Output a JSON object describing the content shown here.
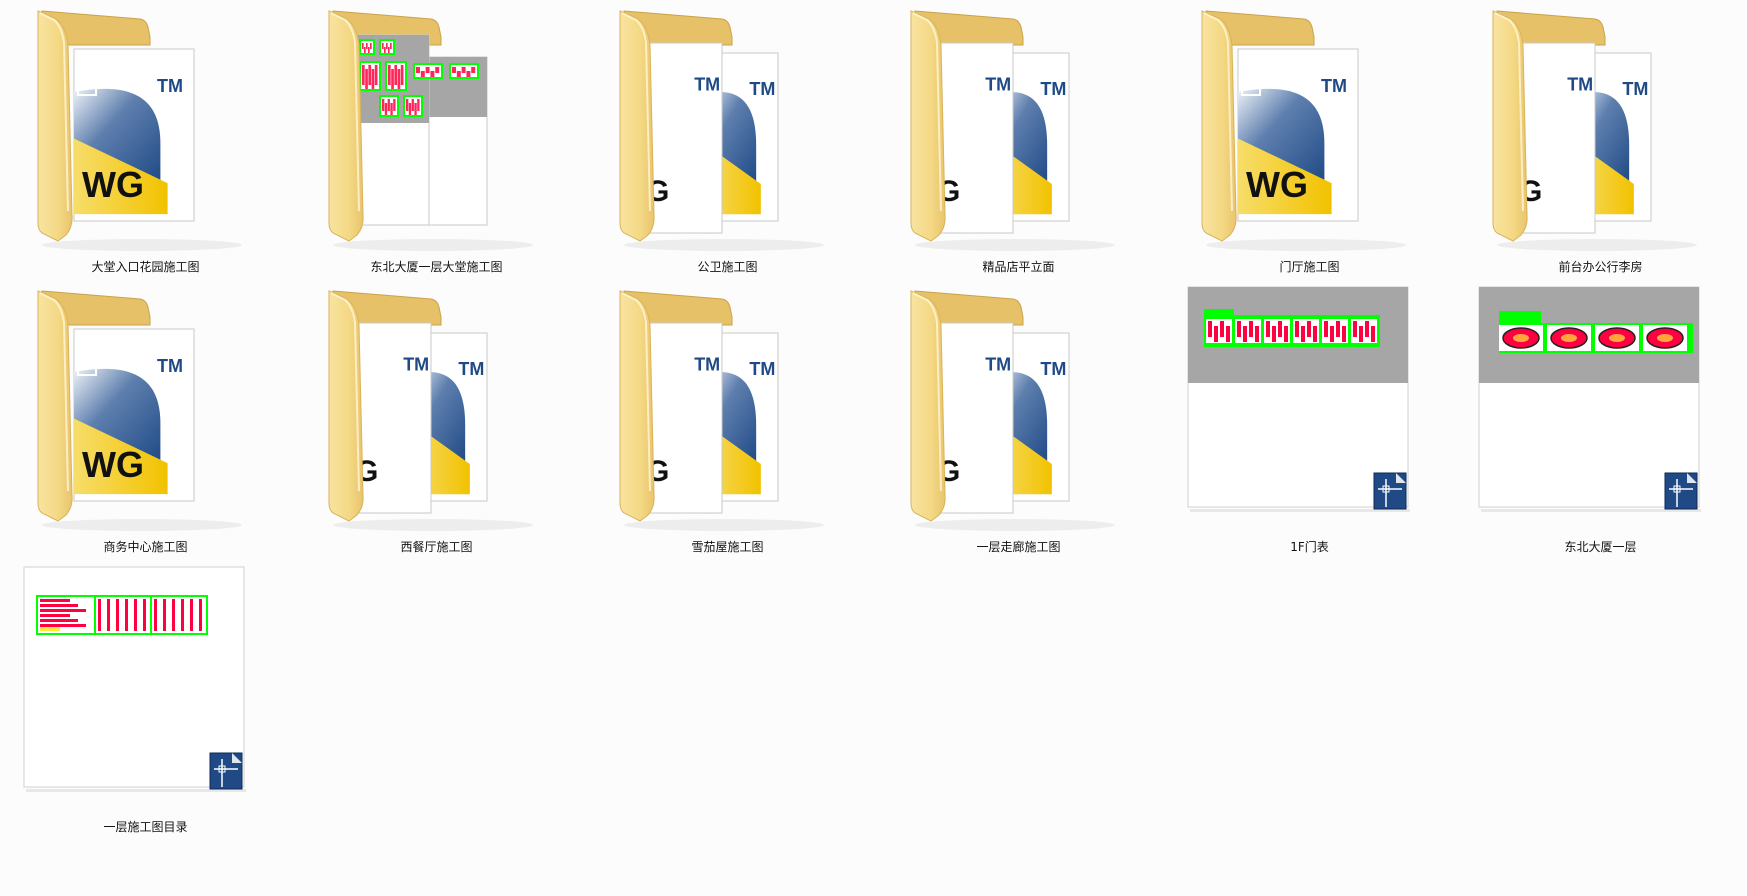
{
  "items": [
    {
      "name": "大堂入口花园施工图",
      "kind": "folder",
      "variant": "single"
    },
    {
      "name": "东北大厦一层大堂施工图",
      "kind": "folder",
      "variant": "preview"
    },
    {
      "name": "公卫施工图",
      "kind": "folder",
      "variant": "double"
    },
    {
      "name": "精品店平立面",
      "kind": "folder",
      "variant": "double"
    },
    {
      "name": "门厅施工图",
      "kind": "folder",
      "variant": "single"
    },
    {
      "name": "前台办公行李房",
      "kind": "folder",
      "variant": "double"
    },
    {
      "name": "商务中心施工图",
      "kind": "folder",
      "variant": "single"
    },
    {
      "name": "西餐厅施工图",
      "kind": "folder",
      "variant": "double"
    },
    {
      "name": "雪茄屋施工图",
      "kind": "folder",
      "variant": "double"
    },
    {
      "name": "一层走廊施工图",
      "kind": "folder",
      "variant": "double"
    },
    {
      "name": "1F门表",
      "kind": "dwg-file",
      "variant": "strip"
    },
    {
      "name": "东北大厦一层",
      "kind": "dwg-file",
      "variant": "plans"
    },
    {
      "name": "一层施工图目录",
      "kind": "dwg-file",
      "variant": "index"
    }
  ],
  "badges": {
    "dwg_text": "DWG",
    "tm_text": "TM"
  },
  "colors": {
    "folder_front": "#f4d884",
    "folder_back": "#e6c168",
    "dwg_yellow": "#f2c200",
    "dwg_blue": "#1f4a86",
    "cad_green": "#00ff00",
    "cad_red": "#ff0040",
    "preview_grey": "#a6a6a6"
  },
  "icons": {
    "folder": "folder-icon",
    "dwg": "dwg-file-icon",
    "cad_badge": "autocad-badge-icon"
  }
}
